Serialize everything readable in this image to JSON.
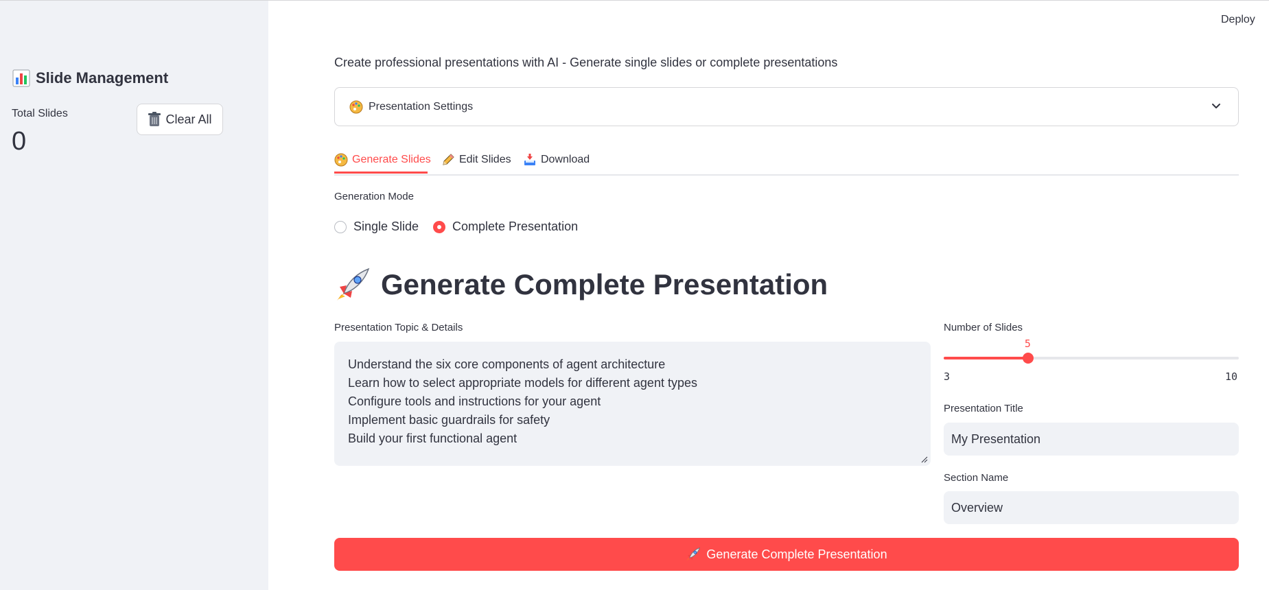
{
  "header": {
    "deploy_label": "Deploy"
  },
  "sidebar": {
    "title": "Slide Management",
    "title_icon": "bar-chart-icon",
    "metric_label": "Total Slides",
    "metric_value": "0",
    "clear_button": {
      "label": "Clear All",
      "icon": "trash-icon"
    }
  },
  "main": {
    "subtitle": "Create professional presentations with AI - Generate single slides or complete presentations",
    "settings_expander": {
      "label": "Presentation Settings",
      "icon": "palette-icon",
      "expanded": false
    },
    "tabs": [
      {
        "label": "Generate Slides",
        "icon": "palette-icon",
        "active": true
      },
      {
        "label": "Edit Slides",
        "icon": "pencil-icon",
        "active": false
      },
      {
        "label": "Download",
        "icon": "inbox-tray-icon",
        "active": false
      }
    ],
    "generation_mode": {
      "label": "Generation Mode",
      "options": [
        {
          "label": "Single Slide",
          "selected": false
        },
        {
          "label": "Complete Presentation",
          "selected": true
        }
      ]
    },
    "section_title": "Generate Complete Presentation",
    "section_icon": "rocket-icon",
    "topic": {
      "label": "Presentation Topic & Details",
      "lines": [
        "Understand the six core components of agent architecture",
        "Learn how to select appropriate models for different agent types",
        "Configure tools and instructions for your agent",
        "Implement basic guardrails for safety",
        "Build your first functional agent"
      ]
    },
    "num_slides": {
      "label": "Number of Slides",
      "value": 5,
      "min": 3,
      "max": 10
    },
    "presentation_title": {
      "label": "Presentation Title",
      "value": "My Presentation"
    },
    "section_name": {
      "label": "Section Name",
      "value": "Overview"
    },
    "generate_button": {
      "label": "Generate Complete Presentation",
      "icon": "rocket-icon"
    }
  },
  "colors": {
    "accent": "#ff4b4b",
    "sidebar_bg": "#f0f2f6",
    "text": "#31333f",
    "input_bg": "#f0f2f6"
  }
}
